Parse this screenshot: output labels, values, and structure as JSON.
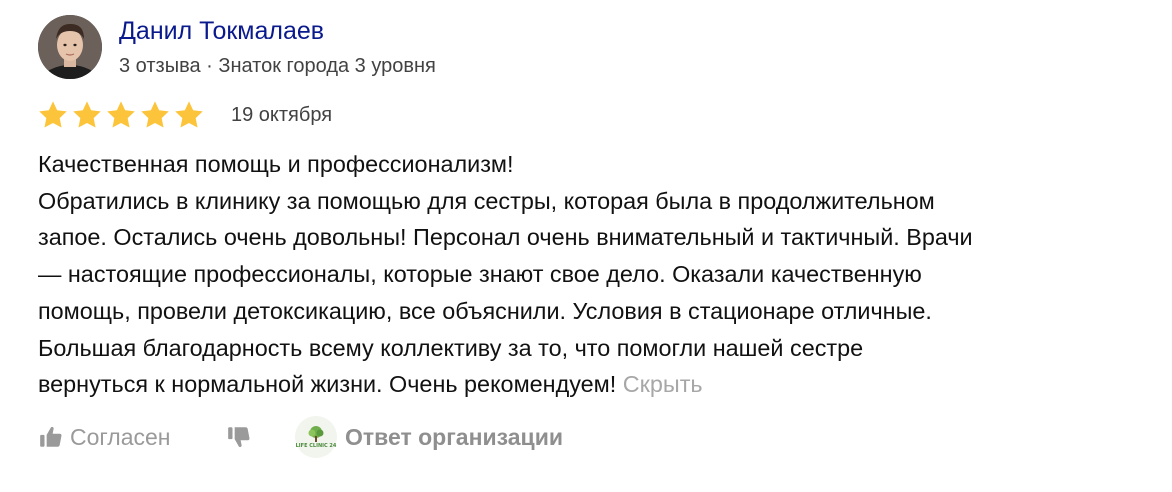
{
  "author": {
    "name": "Данил Токмалаев",
    "meta": "3 отзыва · Знаток города 3 уровня"
  },
  "rating": {
    "value": 5,
    "max": 5,
    "star_color": "#fcc43a"
  },
  "review": {
    "date": "19 октября",
    "lines": [
      "Качественная помощь и профессионализм!",
      "Обратились в клинику за помощью для сестры, которая была в продолжительном",
      "запое. Остались очень довольны! Персонал очень внимательный и тактичный. Врачи",
      "— настоящие профессионалы, которые знают свое дело. Оказали качественную",
      "помощь, провели детоксикацию, все объяснили. Условия в стационаре отличные.",
      "Большая благодарность всему коллективу за то, что помогли нашей сестре",
      "вернуться к нормальной жизни. Очень рекомендуем!"
    ],
    "hide_label": "Скрыть"
  },
  "actions": {
    "like_label": "Согласен",
    "like_icon": "thumbs-up-icon",
    "dislike_icon": "thumbs-down-icon",
    "org_reply_label": "Ответ организации",
    "org_logo_text": "LIFE CLINIC 24"
  },
  "colors": {
    "author_link": "#0a1a8c",
    "muted_text": "#424242",
    "action_gray": "#9a9a9a"
  }
}
